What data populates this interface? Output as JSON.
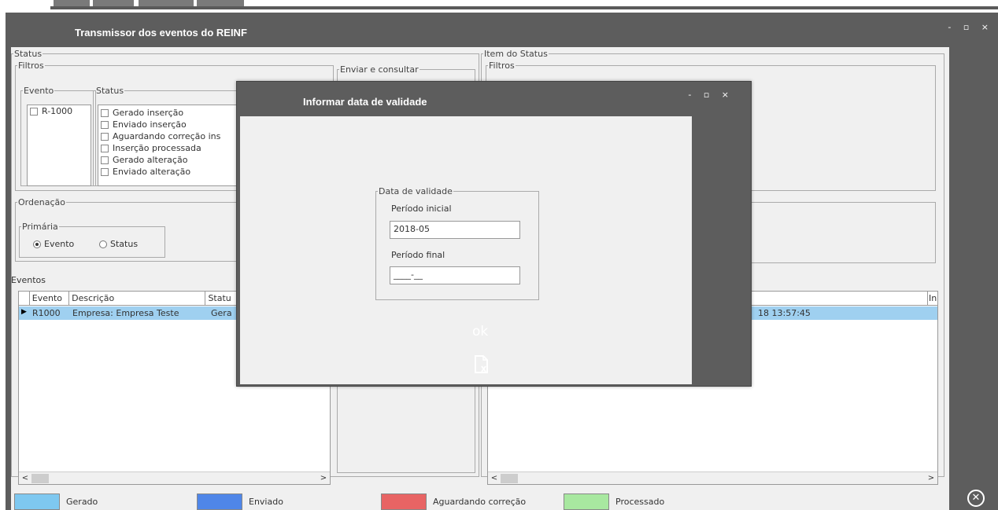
{
  "window": {
    "title": "Transmissor dos eventos do REINF",
    "controls": "- ▫ ×"
  },
  "status_panel": {
    "label": "Status",
    "filtros_label": "Filtros",
    "evento_group": {
      "label": "Evento",
      "items": [
        "R-1000"
      ]
    },
    "status_group": {
      "label": "Status",
      "items": [
        "Gerado inserção",
        "Enviado inserção",
        "Aguardando correção ins",
        "Inserção processada",
        "Gerado alteração",
        "Enviado alteração"
      ]
    },
    "enviar_label": "Enviar e consultar",
    "ordenacao_label": "Ordenação",
    "primaria_label": "Primária",
    "radio_evento": "Evento",
    "radio_status": "Status"
  },
  "events_grid": {
    "label": "Eventos",
    "columns": [
      "Evento",
      "Descrição",
      "Statu"
    ],
    "rows": [
      {
        "evento": "R1000",
        "descricao": "Empresa: Empresa Teste",
        "status": "Gera"
      }
    ]
  },
  "item_status_panel": {
    "label": "Item do Status",
    "filtros_label": "Filtros",
    "grid_last_col": "In",
    "row_datetime": "18 13:57:45"
  },
  "legend": [
    {
      "label": "Gerado",
      "color": "#7ec8f0"
    },
    {
      "label": "Enviado",
      "color": "#4f86e8"
    },
    {
      "label": "Aguardando correção",
      "color": "#e86464"
    },
    {
      "label": "Processado",
      "color": "#a8e8a0"
    }
  ],
  "modal": {
    "title": "Informar data de validade",
    "controls": "- ▫ ×",
    "group_label": "Data de validade",
    "periodo_inicial_label": "Período inicial",
    "periodo_inicial_value": "2018-05",
    "periodo_final_label": "Período final",
    "periodo_final_value": "____-__",
    "ok_label": "ok"
  }
}
